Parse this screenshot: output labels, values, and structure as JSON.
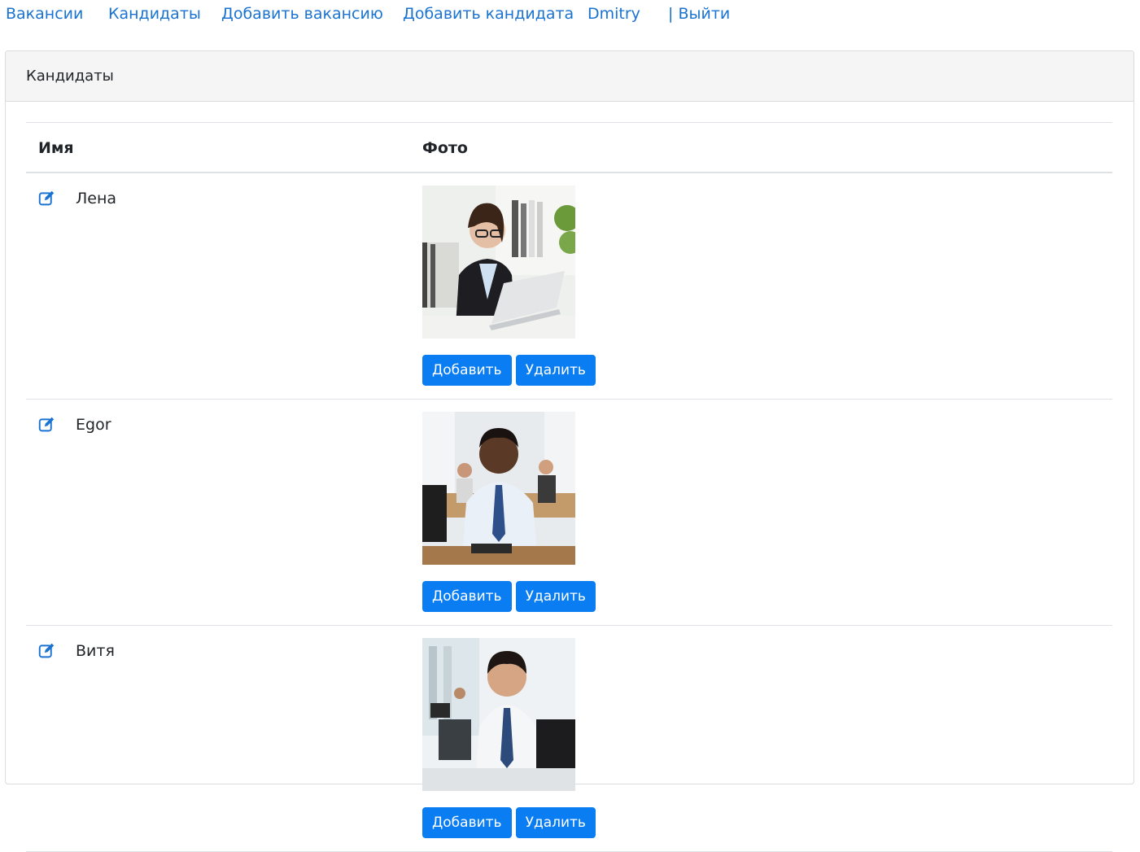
{
  "nav": {
    "items": [
      {
        "label": "Вакансии"
      },
      {
        "label": "Кандидаты"
      },
      {
        "label": "Добавить вакансию"
      },
      {
        "label": "Добавить кандидата"
      },
      {
        "label": "Dmitry"
      },
      {
        "label": "| Выйти"
      }
    ]
  },
  "card": {
    "title": "Кандидаты"
  },
  "table": {
    "headers": {
      "name": "Имя",
      "photo": "Фото"
    },
    "rows": [
      {
        "name": "Лена",
        "add_label": "Добавить",
        "delete_label": "Удалить"
      },
      {
        "name": "Egor",
        "add_label": "Добавить",
        "delete_label": "Удалить"
      },
      {
        "name": "Витя",
        "add_label": "Добавить",
        "delete_label": "Удалить"
      }
    ]
  },
  "colors": {
    "link": "#1a73d1",
    "button": "#0a7df2",
    "header_bg": "#f5f5f5"
  },
  "icons": {
    "edit": "edit-icon"
  }
}
